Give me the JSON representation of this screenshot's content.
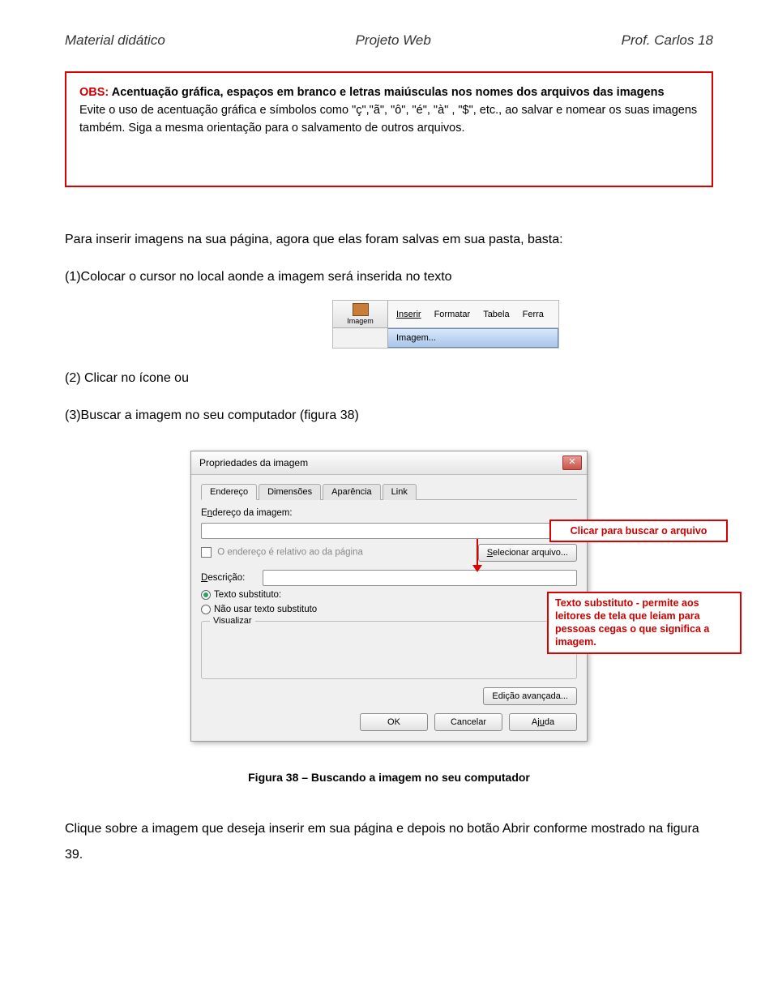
{
  "header": {
    "left": "Material didático",
    "center": "Projeto Web",
    "right": "Prof. Carlos  18"
  },
  "warning": {
    "obs_label": "OBS:",
    "title_rest": " Acentuação gráfica, espaços em branco e letras maiúsculas nos nomes dos arquivos das imagens",
    "body": "Evite o uso de acentuação gráfica e símbolos como \"ç\",\"ã\", \"ô\", \"é\", \"à\" , \"$\", etc., ao salvar e nomear os suas imagens também. Siga a mesma orientação para o salvamento de outros arquivos."
  },
  "body": {
    "p1": "Para inserir imagens na sua página, agora que elas foram salvas em sua pasta, basta:",
    "step1": "(1)Colocar o cursor no local aonde a imagem será inserida no texto",
    "step2": "(2) Clicar no ícone  ou",
    "step3": "(3)Buscar a imagem no seu computador (figura 38)"
  },
  "menu": {
    "image_label": "Imagem",
    "menu_items": {
      "inserir": "Inserir",
      "formatar": "Formatar",
      "tabela": "Tabela",
      "ferra": "Ferra"
    },
    "submenu": "Imagem..."
  },
  "dialog": {
    "title": "Propriedades da imagem",
    "tabs": {
      "endereco": "Endereço",
      "dimensoes": "Dimensões",
      "aparencia": "Aparência",
      "link": "Link"
    },
    "label_endereco": "Endereço da imagem:",
    "cb_relative": "O endereço é relativo ao da página",
    "btn_select": "Selecionar arquivo...",
    "label_descricao": "Descrição:",
    "radio_alt": "Texto substituto:",
    "radio_noalt": "Não usar texto substituto",
    "legend_visualizar": "Visualizar",
    "btn_advanced": "Edição avançada...",
    "btn_ok": "OK",
    "btn_cancel": "Cancelar",
    "btn_help": "Ajuda"
  },
  "callouts": {
    "c1": "Clicar para buscar o arquivo",
    "c2": "Texto substituto - permite aos leitores de tela que leiam para pessoas cegas o que significa a imagem."
  },
  "caption": "Figura 38 – Buscando a imagem no seu computador",
  "final": "Clique sobre a imagem que deseja inserir em sua página e depois no botão Abrir conforme mostrado na figura 39."
}
